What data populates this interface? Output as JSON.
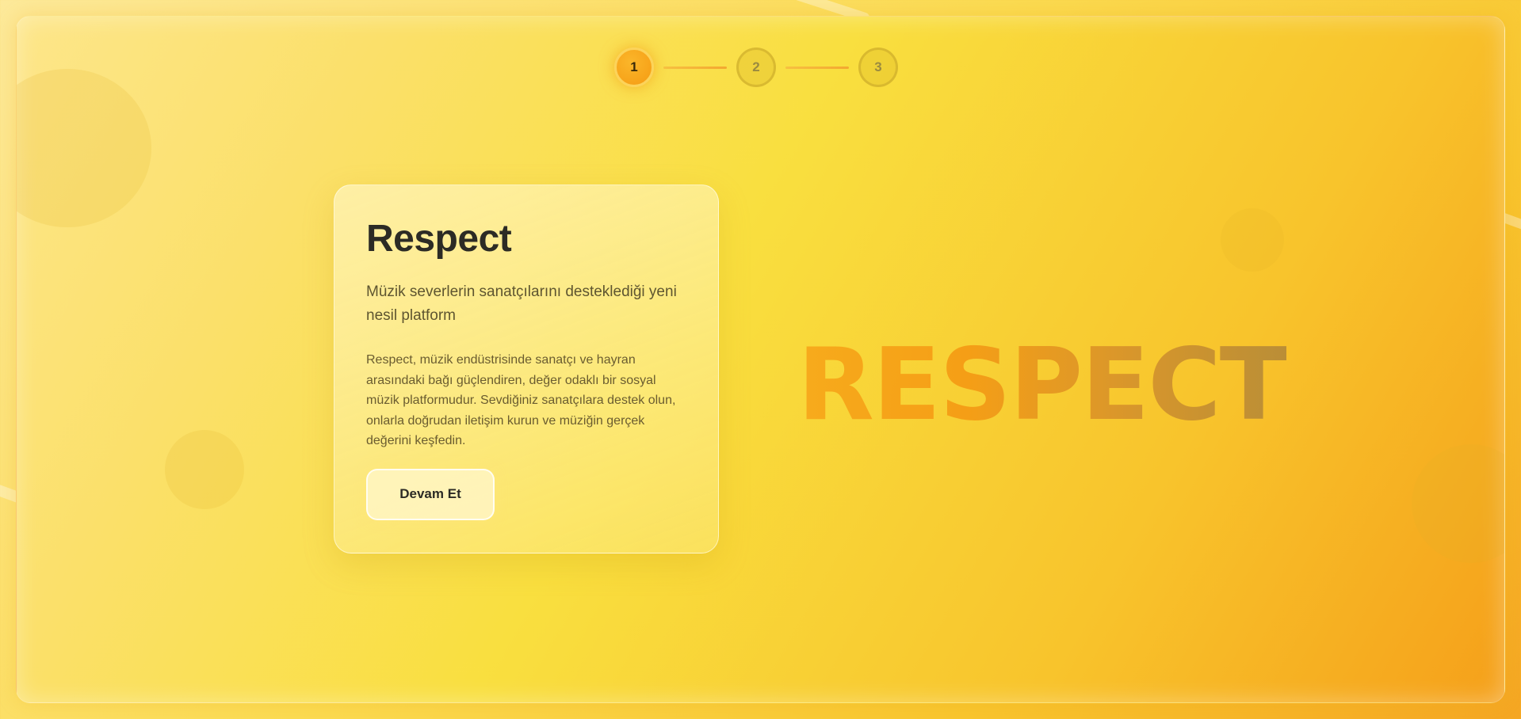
{
  "stepper": {
    "steps": [
      {
        "label": "1",
        "active": true
      },
      {
        "label": "2",
        "active": false
      },
      {
        "label": "3",
        "active": false
      }
    ]
  },
  "card": {
    "title": "Respect",
    "subtitle": "Müzik severlerin sanatçılarını desteklediği yeni nesil platform",
    "description": "Respect, müzik endüstrisinde sanatçı ve hayran arasındaki bağı güçlendiren, değer odaklı bir sosyal müzik platformudur. Sevdiğiniz sanatçılara destek olun, onlarla doğrudan iletişim kurun ve müziğin gerçek değerini keşfedin.",
    "cta_label": "Devam Et"
  },
  "hero": {
    "word": "RESPECT"
  },
  "colors": {
    "accent": "#f59b12",
    "text": "#2c2b25",
    "background_start": "#fde68a",
    "background_end": "#f5a01a"
  }
}
